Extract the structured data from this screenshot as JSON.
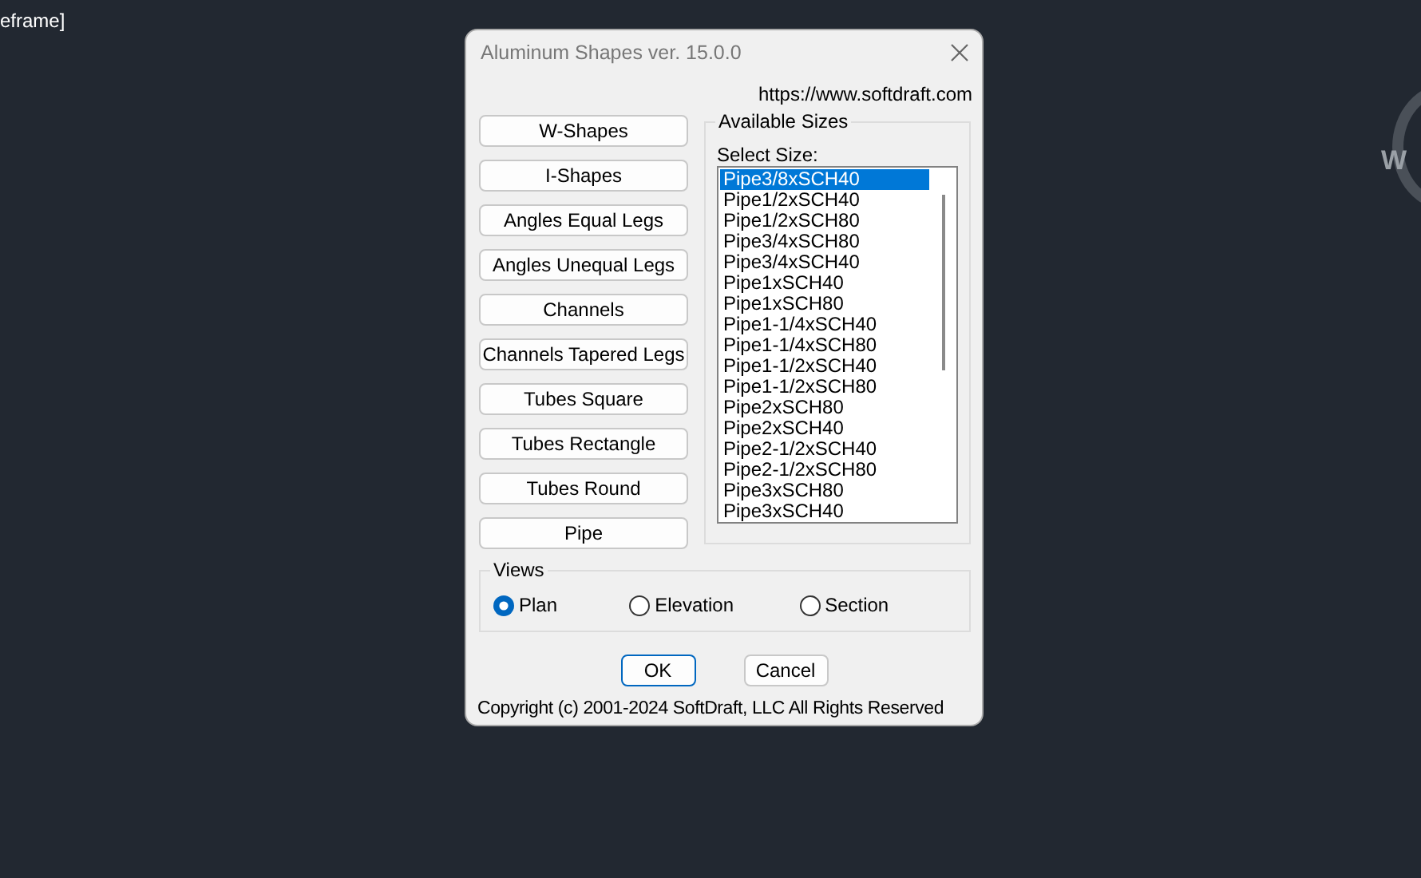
{
  "background_text": "eframe]",
  "view_cube": {
    "label": "W"
  },
  "dialog": {
    "title": "Aluminum Shapes ver. 15.0.0",
    "url": "https://www.softdraft.com",
    "shape_buttons": [
      "W-Shapes",
      "I-Shapes",
      "Angles Equal Legs",
      "Angles Unequal Legs",
      "Channels",
      "Channels Tapered Legs",
      "Tubes Square",
      "Tubes Rectangle",
      "Tubes Round",
      "Pipe"
    ],
    "available_sizes": {
      "title": "Available Sizes",
      "select_label": "Select Size:",
      "items": [
        {
          "label": "Pipe3/8xSCH40",
          "selected": true
        },
        {
          "label": "Pipe1/2xSCH40",
          "selected": false
        },
        {
          "label": "Pipe1/2xSCH80",
          "selected": false
        },
        {
          "label": "Pipe3/4xSCH80",
          "selected": false
        },
        {
          "label": "Pipe3/4xSCH40",
          "selected": false
        },
        {
          "label": "Pipe1xSCH40",
          "selected": false
        },
        {
          "label": "Pipe1xSCH80",
          "selected": false
        },
        {
          "label": "Pipe1-1/4xSCH40",
          "selected": false
        },
        {
          "label": "Pipe1-1/4xSCH80",
          "selected": false
        },
        {
          "label": "Pipe1-1/2xSCH40",
          "selected": false
        },
        {
          "label": "Pipe1-1/2xSCH80",
          "selected": false
        },
        {
          "label": "Pipe2xSCH80",
          "selected": false
        },
        {
          "label": "Pipe2xSCH40",
          "selected": false
        },
        {
          "label": "Pipe2-1/2xSCH40",
          "selected": false
        },
        {
          "label": "Pipe2-1/2xSCH80",
          "selected": false
        },
        {
          "label": "Pipe3xSCH80",
          "selected": false
        },
        {
          "label": "Pipe3xSCH40",
          "selected": false
        }
      ]
    },
    "views": {
      "title": "Views",
      "options": [
        {
          "label": "Plan",
          "selected": true
        },
        {
          "label": "Elevation",
          "selected": false
        },
        {
          "label": "Section",
          "selected": false
        }
      ]
    },
    "buttons": [
      {
        "label": "OK",
        "default": true
      },
      {
        "label": "Cancel",
        "default": false
      }
    ],
    "copyright": "Copyright (c) 2001-2024 SoftDraft, LLC All Rights Reserved"
  }
}
